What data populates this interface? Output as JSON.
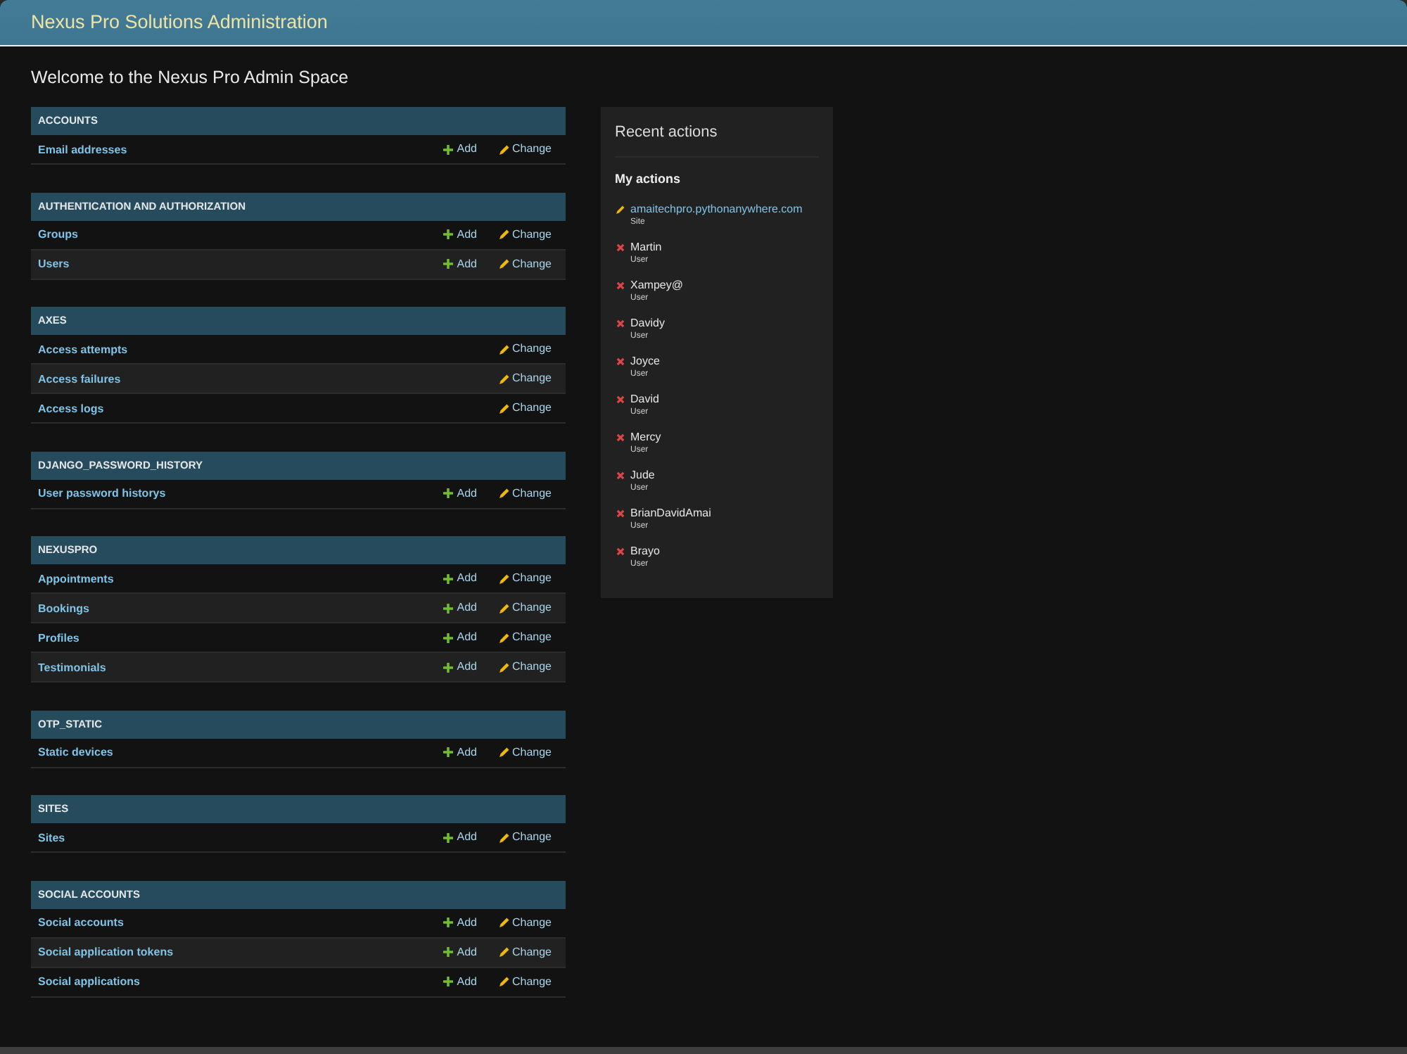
{
  "header": {
    "title": "Nexus Pro Solutions Administration"
  },
  "welcome": "Welcome to the Nexus Pro Admin Space",
  "modules": [
    {
      "caption": "ACCOUNTS",
      "models": [
        {
          "name": "Email addresses",
          "actions": [
            {
              "kind": "add",
              "label": "Add"
            },
            {
              "kind": "change",
              "label": "Change"
            }
          ]
        }
      ]
    },
    {
      "caption": "AUTHENTICATION AND AUTHORIZATION",
      "models": [
        {
          "name": "Groups",
          "actions": [
            {
              "kind": "add",
              "label": "Add"
            },
            {
              "kind": "change",
              "label": "Change"
            }
          ]
        },
        {
          "name": "Users",
          "actions": [
            {
              "kind": "add",
              "label": "Add"
            },
            {
              "kind": "change",
              "label": "Change"
            }
          ]
        }
      ]
    },
    {
      "caption": "AXES",
      "models": [
        {
          "name": "Access attempts",
          "actions": [
            {
              "kind": "change",
              "label": "Change"
            }
          ]
        },
        {
          "name": "Access failures",
          "actions": [
            {
              "kind": "change",
              "label": "Change"
            }
          ]
        },
        {
          "name": "Access logs",
          "actions": [
            {
              "kind": "change",
              "label": "Change"
            }
          ]
        }
      ]
    },
    {
      "caption": "DJANGO_PASSWORD_HISTORY",
      "models": [
        {
          "name": "User password historys",
          "actions": [
            {
              "kind": "add",
              "label": "Add"
            },
            {
              "kind": "change",
              "label": "Change"
            }
          ]
        }
      ]
    },
    {
      "caption": "NEXUSPRO",
      "models": [
        {
          "name": "Appointments",
          "actions": [
            {
              "kind": "add",
              "label": "Add"
            },
            {
              "kind": "change",
              "label": "Change"
            }
          ]
        },
        {
          "name": "Bookings",
          "actions": [
            {
              "kind": "add",
              "label": "Add"
            },
            {
              "kind": "change",
              "label": "Change"
            }
          ]
        },
        {
          "name": "Profiles",
          "actions": [
            {
              "kind": "add",
              "label": "Add"
            },
            {
              "kind": "change",
              "label": "Change"
            }
          ]
        },
        {
          "name": "Testimonials",
          "actions": [
            {
              "kind": "add",
              "label": "Add"
            },
            {
              "kind": "change",
              "label": "Change"
            }
          ]
        }
      ]
    },
    {
      "caption": "OTP_STATIC",
      "models": [
        {
          "name": "Static devices",
          "actions": [
            {
              "kind": "add",
              "label": "Add"
            },
            {
              "kind": "change",
              "label": "Change"
            }
          ]
        }
      ]
    },
    {
      "caption": "SITES",
      "models": [
        {
          "name": "Sites",
          "actions": [
            {
              "kind": "add",
              "label": "Add"
            },
            {
              "kind": "change",
              "label": "Change"
            }
          ]
        }
      ]
    },
    {
      "caption": "SOCIAL ACCOUNTS",
      "models": [
        {
          "name": "Social accounts",
          "actions": [
            {
              "kind": "add",
              "label": "Add"
            },
            {
              "kind": "change",
              "label": "Change"
            }
          ]
        },
        {
          "name": "Social application tokens",
          "actions": [
            {
              "kind": "add",
              "label": "Add"
            },
            {
              "kind": "change",
              "label": "Change"
            }
          ]
        },
        {
          "name": "Social applications",
          "actions": [
            {
              "kind": "add",
              "label": "Add"
            },
            {
              "kind": "change",
              "label": "Change"
            }
          ]
        }
      ]
    }
  ],
  "recent_actions": {
    "title": "Recent actions",
    "subtitle": "My actions",
    "items": [
      {
        "kind": "change",
        "name": "amaitechpro.pythonanywhere.com",
        "type": "Site"
      },
      {
        "kind": "delete",
        "name": "Martin",
        "type": "User"
      },
      {
        "kind": "delete",
        "name": "Xampey@",
        "type": "User"
      },
      {
        "kind": "delete",
        "name": "Davidy",
        "type": "User"
      },
      {
        "kind": "delete",
        "name": "Joyce",
        "type": "User"
      },
      {
        "kind": "delete",
        "name": "David",
        "type": "User"
      },
      {
        "kind": "delete",
        "name": "Mercy",
        "type": "User"
      },
      {
        "kind": "delete",
        "name": "Jude",
        "type": "User"
      },
      {
        "kind": "delete",
        "name": "BrianDavidAmai",
        "type": "User"
      },
      {
        "kind": "delete",
        "name": "Brayo",
        "type": "User"
      }
    ]
  }
}
